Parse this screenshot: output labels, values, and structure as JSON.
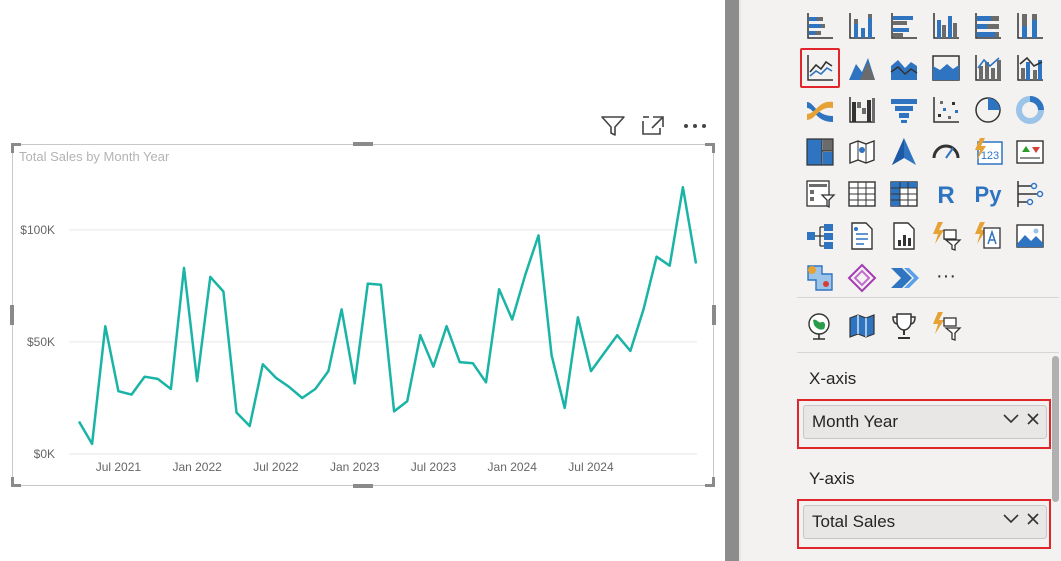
{
  "visual": {
    "title": "Total Sales by Month Year",
    "header_icons": [
      "filter-icon",
      "focus-mode-icon",
      "more-options-icon"
    ]
  },
  "chart_data": {
    "type": "line",
    "title": "Total Sales by Month Year",
    "xlabel": "",
    "ylabel": "",
    "x_ticks": [
      "Jul 2021",
      "Jan 2022",
      "Jul 2022",
      "Jan 2023",
      "Jul 2023",
      "Jan 2024",
      "Jul 2024"
    ],
    "y_ticks": [
      "$0K",
      "$50K",
      "$100K"
    ],
    "ylim": [
      0,
      120000
    ],
    "grid": true,
    "color": "#1ab4a6",
    "series": [
      {
        "values": [
          14500,
          4500,
          57000,
          28000,
          26500,
          34500,
          33500,
          29000,
          83000,
          32500,
          79000,
          72500,
          18500,
          12500,
          40000,
          34000,
          30000,
          25000,
          29000,
          37000,
          64500,
          31500,
          76000,
          75500,
          19000,
          23500,
          53000,
          39000,
          57000,
          41000,
          40500,
          32000,
          73500,
          60000,
          80000,
          97500,
          44000,
          20500,
          61000,
          37000,
          45000,
          53000,
          46000,
          64500,
          88000,
          84000,
          119000,
          85000
        ]
      }
    ]
  },
  "pane": {
    "icons": [
      "stacked-bar-chart-icon",
      "stacked-column-chart-icon",
      "clustered-bar-chart-icon",
      "clustered-column-chart-icon",
      "100-stacked-bar-chart-icon",
      "100-stacked-column-chart-icon",
      "line-chart-icon",
      "area-chart-icon",
      "stacked-area-chart-icon",
      "100-stacked-area-chart-icon",
      "line-and-stacked-column-chart-icon",
      "line-and-clustered-column-chart-icon",
      "ribbon-chart-icon",
      "waterfall-chart-icon",
      "funnel-chart-icon",
      "scatter-chart-icon",
      "pie-chart-icon",
      "donut-chart-icon",
      "treemap-icon",
      "map-icon",
      "azure-map-icon",
      "gauge-icon",
      "card-icon",
      "kpi-icon",
      "slicer-icon",
      "table-icon",
      "matrix-icon",
      "r-visual-icon",
      "python-visual-icon",
      "key-influencers-icon",
      "decomposition-tree-icon",
      "smart-narrative-icon",
      "paginated-report-icon",
      "q-and-a-icon",
      "narrative-icon",
      "image-icon",
      "shape-map-icon",
      "power-apps-icon",
      "power-automate-icon",
      "more-visuals-icon",
      "arcgis-map-icon",
      "filled-map-icon",
      "trophy-icon",
      "metrics-slicer-icon"
    ],
    "x_axis": {
      "label": "X-axis",
      "field": "Month Year"
    },
    "y_axis": {
      "label": "Y-axis",
      "field": "Total Sales"
    }
  },
  "text": {
    "r": "R",
    "py": "Py",
    "card_num": "123",
    "more": "···"
  }
}
